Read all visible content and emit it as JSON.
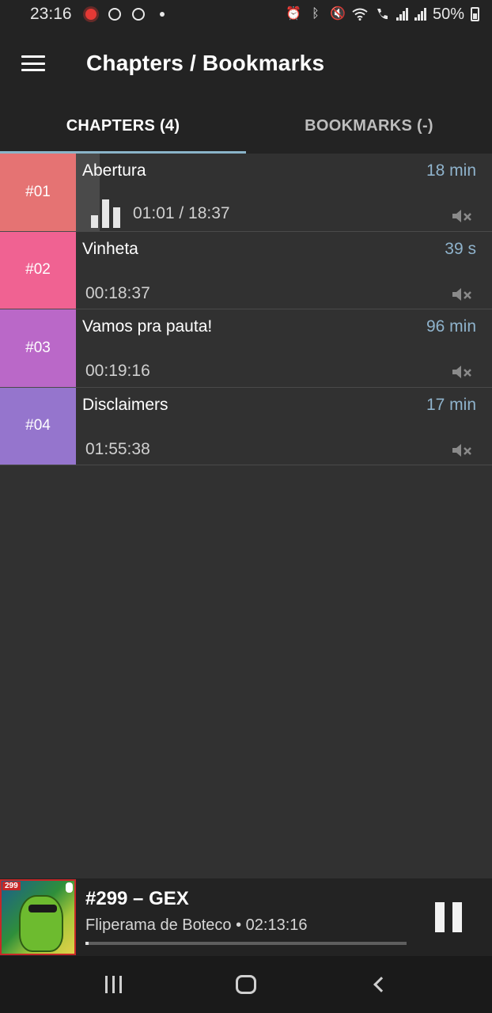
{
  "status_bar": {
    "time": "23:16",
    "battery": "50%"
  },
  "app_bar": {
    "title": "Chapters / Bookmarks"
  },
  "tabs": [
    {
      "label": "CHAPTERS (4)",
      "active": true
    },
    {
      "label": "BOOKMARKS (-)",
      "active": false
    }
  ],
  "chapters": [
    {
      "number": "#01",
      "title": "Abertura",
      "duration": "18 min",
      "time": "01:01 / 18:37",
      "color": "#e57373",
      "playing": true
    },
    {
      "number": "#02",
      "title": "Vinheta",
      "duration": "39 s",
      "time": "00:18:37",
      "color": "#f06292",
      "playing": false
    },
    {
      "number": "#03",
      "title": "Vamos pra pauta!",
      "duration": "96 min",
      "time": "00:19:16",
      "color": "#ba68c8",
      "playing": false
    },
    {
      "number": "#04",
      "title": "Disclaimers",
      "duration": "17 min",
      "time": "01:55:38",
      "color": "#9575cd",
      "playing": false
    }
  ],
  "player": {
    "cover_badge": "299",
    "episode_title": "#299 – GEX",
    "subtitle": "Fliperama de Boteco • 02:13:16",
    "progress": 0.01
  }
}
